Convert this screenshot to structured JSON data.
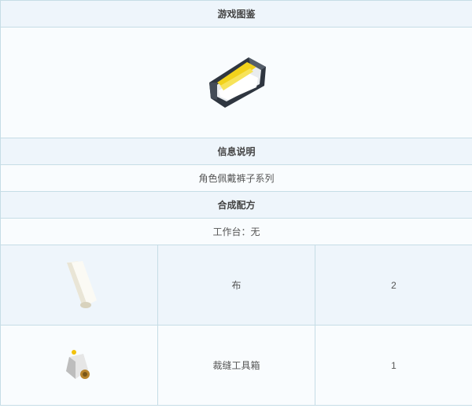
{
  "header": {
    "title": "游戏图鉴"
  },
  "item": {
    "image_icon": "belt-item-icon"
  },
  "info": {
    "title": "信息说明",
    "description": "角色佩戴裤子系列"
  },
  "recipe": {
    "title": "合成配方",
    "workbench": "工作台：无",
    "materials": [
      {
        "icon": "cloth-icon",
        "name": "布",
        "qty": "2"
      },
      {
        "icon": "sewing-toolbox-icon",
        "name": "裁缝工具箱",
        "qty": "1"
      }
    ]
  },
  "colors": {
    "border": "#c6dde6",
    "header_bg": "#eef5fb",
    "body_bg": "#f9fcfe"
  }
}
